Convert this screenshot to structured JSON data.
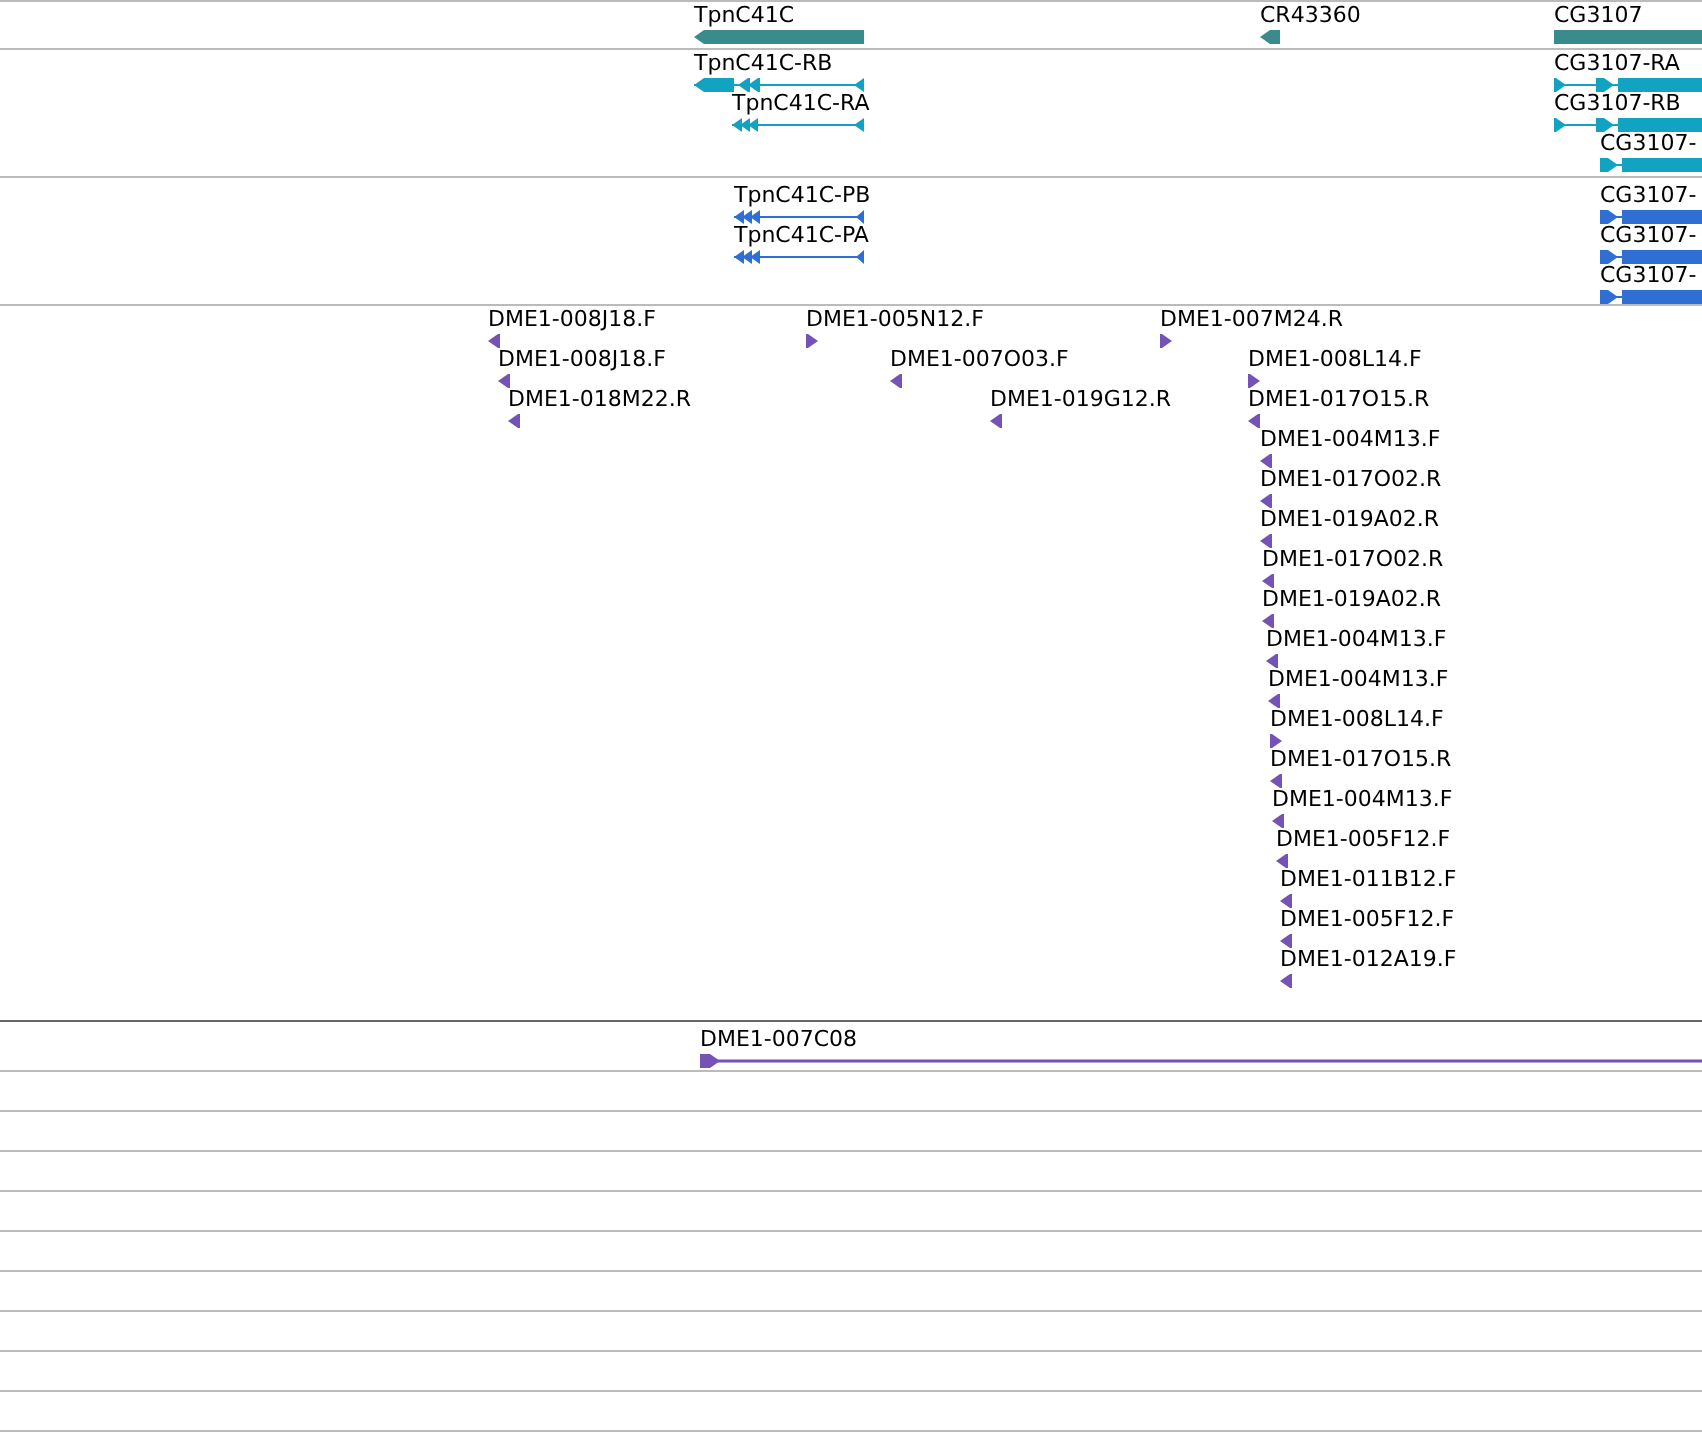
{
  "tracks": [
    {
      "kind": "gene",
      "features": [
        {
          "label": "TpnC41C",
          "reverse": true
        },
        {
          "label": "CR43360",
          "reverse": true
        },
        {
          "label": "CG3107",
          "reverse": false
        }
      ]
    },
    {
      "kind": "transcript",
      "features": [
        {
          "label": "TpnC41C-RB",
          "reverse": true
        },
        {
          "label": "TpnC41C-RA",
          "reverse": true
        },
        {
          "label": "CG3107-RA",
          "reverse": false
        },
        {
          "label": "CG3107-RB",
          "reverse": false
        },
        {
          "label": "CG3107-",
          "reverse": false
        }
      ]
    },
    {
      "kind": "protein",
      "features": [
        {
          "label": "TpnC41C-PB",
          "reverse": true
        },
        {
          "label": "TpnC41C-PA",
          "reverse": true
        },
        {
          "label": "CG3107-",
          "reverse": false
        },
        {
          "label": "CG3107-",
          "reverse": false
        },
        {
          "label": "CG3107-",
          "reverse": false
        }
      ]
    },
    {
      "kind": "est",
      "features": [
        {
          "label": "DME1-008J18.F",
          "reverse": true
        },
        {
          "label": "DME1-008J18.F",
          "reverse": true
        },
        {
          "label": "DME1-018M22.R",
          "reverse": true
        },
        {
          "label": "DME1-005N12.F",
          "reverse": false
        },
        {
          "label": "DME1-007O03.F",
          "reverse": true
        },
        {
          "label": "DME1-019G12.R",
          "reverse": true
        },
        {
          "label": "DME1-007M24.R",
          "reverse": false
        },
        {
          "label": "DME1-008L14.F",
          "reverse": false
        },
        {
          "label": "DME1-017O15.R",
          "reverse": true
        },
        {
          "label": "DME1-004M13.F",
          "reverse": true
        },
        {
          "label": "DME1-017O02.R",
          "reverse": true
        },
        {
          "label": "DME1-019A02.R",
          "reverse": true
        },
        {
          "label": "DME1-017O02.R",
          "reverse": true
        },
        {
          "label": "DME1-019A02.R",
          "reverse": true
        },
        {
          "label": "DME1-004M13.F",
          "reverse": true
        },
        {
          "label": "DME1-004M13.F",
          "reverse": true
        },
        {
          "label": "DME1-008L14.F",
          "reverse": false
        },
        {
          "label": "DME1-017O15.R",
          "reverse": true
        },
        {
          "label": "DME1-004M13.F",
          "reverse": true
        },
        {
          "label": "DME1-005F12.F",
          "reverse": true
        },
        {
          "label": "DME1-011B12.F",
          "reverse": true
        },
        {
          "label": "DME1-005F12.F",
          "reverse": true
        },
        {
          "label": "DME1-012A19.F",
          "reverse": true
        }
      ]
    },
    {
      "kind": "cdna",
      "features": [
        {
          "label": "DME1-007C08",
          "reverse": false
        }
      ]
    }
  ]
}
